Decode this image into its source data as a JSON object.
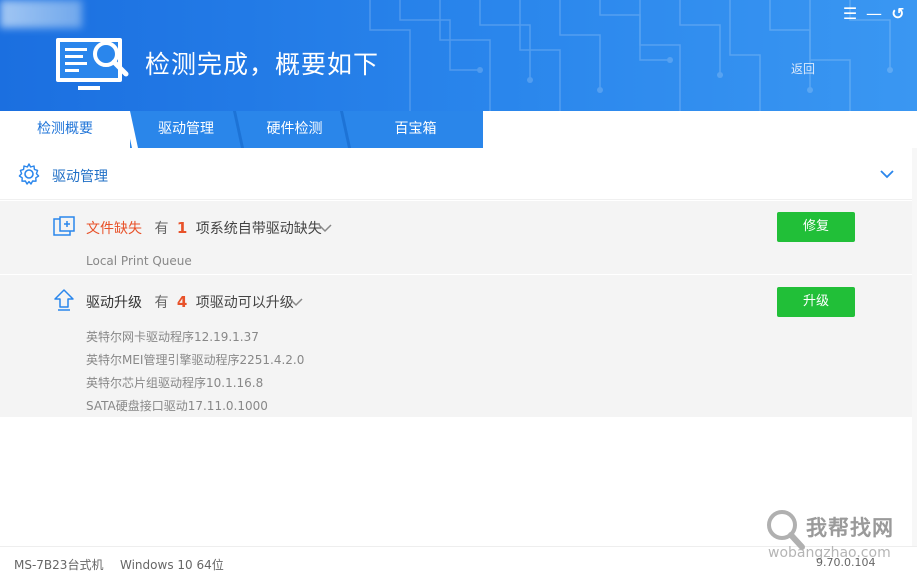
{
  "header": {
    "title": "检测完成，概要如下",
    "back_label": "返回",
    "window_controls": {
      "menu": "☰",
      "minimize": "—",
      "back": "↺"
    }
  },
  "tabs": [
    {
      "label": "检测概要",
      "active": true
    },
    {
      "label": "驱动管理",
      "active": false
    },
    {
      "label": "硬件检测",
      "active": false
    },
    {
      "label": "百宝箱",
      "active": false
    }
  ],
  "section": {
    "title": "驱动管理"
  },
  "rows": [
    {
      "title": "文件缺失",
      "prefix": "有",
      "count": "1",
      "suffix": "项系统自带驱动缺失",
      "items": [
        "Local Print Queue"
      ],
      "button": "修复",
      "icon": "missing-file-icon",
      "title_color": "#e8522a"
    },
    {
      "title": "驱动升级",
      "prefix": "有",
      "count": "4",
      "suffix": "项驱动可以升级",
      "items": [
        "英特尔网卡驱动程序12.19.1.37",
        "英特尔MEI管理引擎驱动程序2251.4.2.0",
        "英特尔芯片组驱动程序10.1.16.8",
        "SATA硬盘接口驱动17.11.0.1000"
      ],
      "button": "升级",
      "icon": "upgrade-arrow-icon",
      "title_color": "#333333"
    }
  ],
  "footer": {
    "model": "MS-7B23台式机",
    "os": "Windows 10 64位",
    "version": "9.70.0.104"
  },
  "watermark": {
    "text": "我帮找网",
    "url": "wobangzhao.com"
  },
  "colors": {
    "header_blue": "#2a86ec",
    "accent_blue": "#1f74d8",
    "button_green": "#21bf38",
    "warning_red": "#e8522a"
  }
}
